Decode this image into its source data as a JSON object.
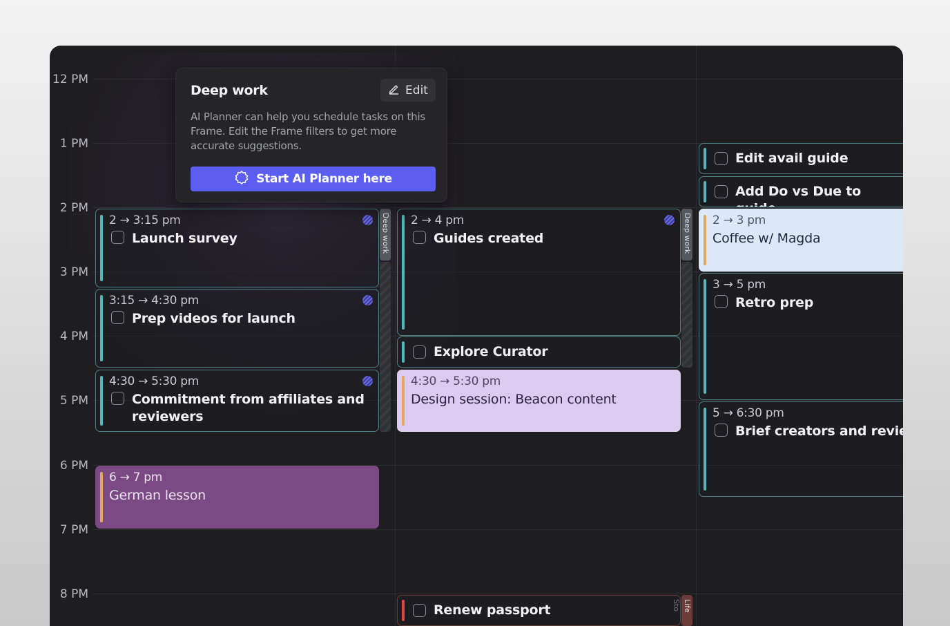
{
  "hours": [
    "12 PM",
    "1 PM",
    "2 PM",
    "3 PM",
    "4 PM",
    "5 PM",
    "6 PM",
    "7 PM",
    "8 PM"
  ],
  "popup": {
    "title": "Deep work",
    "edit_label": "Edit",
    "description": "AI Planner can help you schedule tasks on this Frame. Edit the Frame filters to get more accurate suggestions.",
    "button_label": "Start AI Planner here"
  },
  "side_tabs": {
    "deep_work": "Deep work",
    "life": "Life Sto"
  },
  "columns": [
    {
      "events": [
        {
          "time": "2 → 3:15 pm",
          "title": "Launch survey"
        },
        {
          "time": "3:15 → 4:30 pm",
          "title": "Prep videos for launch"
        },
        {
          "time": "4:30 → 5:30 pm",
          "title": "Commitment from affiliates and reviewers"
        },
        {
          "time": "6 → 7 pm",
          "title": "German lesson"
        }
      ]
    },
    {
      "events": [
        {
          "time": "2 → 4 pm",
          "title": "Guides created"
        },
        {
          "title": "Explore Curator"
        },
        {
          "time": "4:30 → 5:30 pm",
          "title": "Design session: Beacon content"
        },
        {
          "title": "Renew passport"
        }
      ]
    },
    {
      "events": [
        {
          "title": "Edit avail guide"
        },
        {
          "title": "Add Do vs Due to guide"
        },
        {
          "time": "2 → 3 pm",
          "title": "Coffee w/ Magda"
        },
        {
          "time": "3 → 5 pm",
          "title": "Retro prep"
        },
        {
          "time": "5 → 6:30 pm",
          "title": "Brief creators and reviewers"
        }
      ]
    }
  ]
}
